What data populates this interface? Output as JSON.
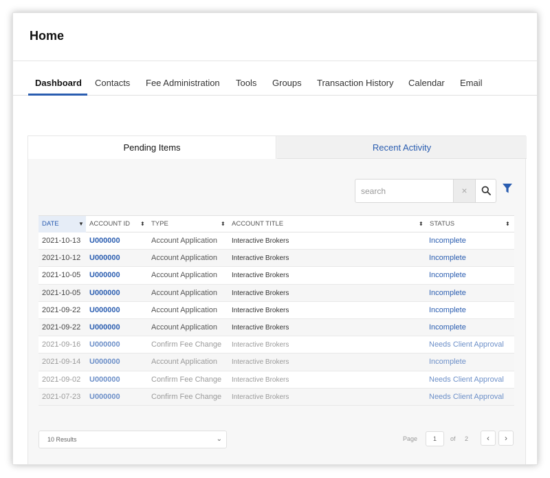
{
  "page": {
    "title": "Home"
  },
  "nav_tabs": [
    "Dashboard",
    "Contacts",
    "Fee Administration",
    "Tools",
    "Groups",
    "Transaction History",
    "Calendar",
    "Email"
  ],
  "card_tabs": {
    "pending": "Pending Items",
    "recent": "Recent Activity"
  },
  "search": {
    "placeholder": "search",
    "clear_glyph": "×"
  },
  "table": {
    "columns": [
      "DATE",
      "ACCOUNT ID",
      "TYPE",
      "ACCOUNT TITLE",
      "STATUS"
    ],
    "rows": [
      {
        "date": "2021-10-13",
        "account_id": "U000000",
        "type": "Account Application",
        "title": "Interactive Brokers",
        "status": "Incomplete"
      },
      {
        "date": "2021-10-12",
        "account_id": "U000000",
        "type": "Account Application",
        "title": "Interactive Brokers",
        "status": "Incomplete"
      },
      {
        "date": "2021-10-05",
        "account_id": "U000000",
        "type": "Account Application",
        "title": "Interactive Brokers",
        "status": "Incomplete"
      },
      {
        "date": "2021-10-05",
        "account_id": "U000000",
        "type": "Account Application",
        "title": "Interactive Brokers",
        "status": "Incomplete"
      },
      {
        "date": "2021-09-22",
        "account_id": "U000000",
        "type": "Account Application",
        "title": "Interactive Brokers",
        "status": "Incomplete"
      },
      {
        "date": "2021-09-22",
        "account_id": "U000000",
        "type": "Account Application",
        "title": "Interactive Brokers",
        "status": "Incomplete"
      },
      {
        "date": "2021-09-16",
        "account_id": "U000000",
        "type": "Confirm Fee Change",
        "title": "Interactive Brokers",
        "status": "Needs Client Approval"
      },
      {
        "date": "2021-09-14",
        "account_id": "U000000",
        "type": "Account Application",
        "title": "Interactive Brokers",
        "status": "Incomplete"
      },
      {
        "date": "2021-09-02",
        "account_id": "U000000",
        "type": "Confirm Fee Change",
        "title": "Interactive Brokers",
        "status": "Needs Client Approval"
      },
      {
        "date": "2021-07-23",
        "account_id": "U000000",
        "type": "Confirm Fee Change",
        "title": "Interactive Brokers",
        "status": "Needs Client Approval"
      }
    ]
  },
  "pagination": {
    "results_label": "10 Results",
    "page_label": "Page",
    "current_page": "1",
    "of_label": "of",
    "total_pages": "2",
    "prev_glyph": "‹",
    "next_glyph": "›"
  },
  "colors": {
    "accent": "#2a5db0",
    "border": "#e1e1e1",
    "row_alt": "#f6f6f6"
  },
  "icons": [
    "search-icon",
    "clear-icon",
    "filter-icon",
    "sort-icon",
    "chevron-down-icon",
    "chevron-left-icon",
    "chevron-right-icon"
  ]
}
